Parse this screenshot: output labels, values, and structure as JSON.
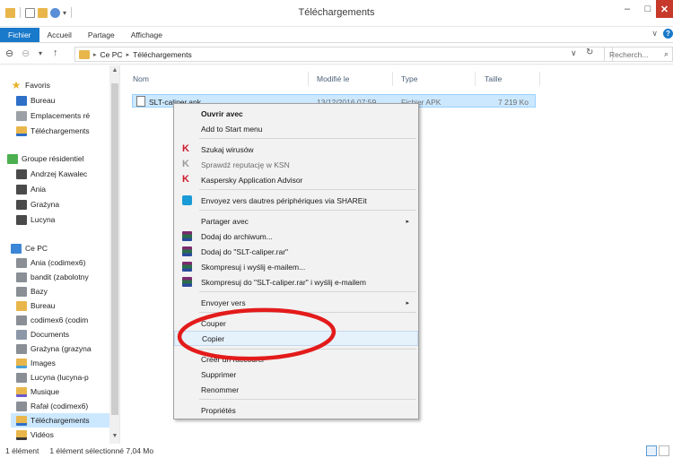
{
  "window": {
    "title": "Téléchargements",
    "min": "–",
    "max": "□",
    "close": "✕"
  },
  "ribbon": {
    "tabs": [
      "Fichier",
      "Accueil",
      "Partage",
      "Affichage"
    ],
    "expand": "∨",
    "help": "?"
  },
  "nav": {
    "back": "⊖",
    "forward": "⊖",
    "recent": "▾",
    "up": "↑",
    "path": [
      "Ce PC",
      "Téléchargements"
    ],
    "path_sep": "▸",
    "dropdown": "∨",
    "refresh": "↻",
    "search_placeholder": "Recherch...",
    "search_icon": "⌕"
  },
  "sidebar": {
    "items": [
      {
        "label": "Favoris",
        "icon": "star-icon"
      },
      {
        "label": "Bureau",
        "icon": "desktop-icon"
      },
      {
        "label": "Emplacements ré",
        "icon": "recent-places-icon"
      },
      {
        "label": "Téléchargements",
        "icon": "download-folder-icon"
      },
      {
        "label": "Groupe résidentiel",
        "icon": "homegroup-icon"
      },
      {
        "label": "Andrzej Kawalec",
        "icon": "user-icon"
      },
      {
        "label": "Ania",
        "icon": "user-icon"
      },
      {
        "label": "Grażyna",
        "icon": "user-icon"
      },
      {
        "label": "Lucyna",
        "icon": "user-icon"
      },
      {
        "label": "Ce PC",
        "icon": "computer-icon"
      },
      {
        "label": "Ania (codimex6)",
        "icon": "network-drive-icon"
      },
      {
        "label": "bandit (zabolotny",
        "icon": "network-drive-icon"
      },
      {
        "label": "Bazy",
        "icon": "network-drive-icon"
      },
      {
        "label": "Bureau",
        "icon": "folder-icon"
      },
      {
        "label": "codimex6 (codim",
        "icon": "network-drive-icon"
      },
      {
        "label": "Documents",
        "icon": "documents-icon"
      },
      {
        "label": "Grażyna (grazyna",
        "icon": "network-drive-icon"
      },
      {
        "label": "Images",
        "icon": "pictures-icon"
      },
      {
        "label": "Lucyna (lucyna-p",
        "icon": "network-drive-icon"
      },
      {
        "label": "Musique",
        "icon": "music-icon"
      },
      {
        "label": "Rafał (codimex6)",
        "icon": "network-drive-icon"
      },
      {
        "label": "Téléchargements",
        "icon": "download-folder-icon"
      },
      {
        "label": "Vidéos",
        "icon": "videos-icon"
      }
    ]
  },
  "columns": {
    "name": "Nom",
    "modified": "Modifié le",
    "type": "Type",
    "size": "Taille"
  },
  "file": {
    "name": "SLT-caliper.apk",
    "modified": "13/12/2016 07:59",
    "type": "Fichier APK",
    "size": "7 219 Ko"
  },
  "context_menu": {
    "items": [
      {
        "label": "Ouvrir avec"
      },
      {
        "label": "Add to Start menu"
      },
      {
        "label": "Szukaj wirusów"
      },
      {
        "label": "Sprawdź reputację w KSN"
      },
      {
        "label": "Kaspersky Application Advisor"
      },
      {
        "label": "Envoyez vers dautres périphériques via SHAREit"
      },
      {
        "label": "Partager avec"
      },
      {
        "label": "Dodaj do archiwum..."
      },
      {
        "label": "Dodaj do \"SLT-caliper.rar\""
      },
      {
        "label": "Skompresuj i wyślij e-mailem..."
      },
      {
        "label": "Skompresuj do \"SLT-caliper.rar\" i wyślij e-mailem"
      },
      {
        "label": "Envoyer vers"
      },
      {
        "label": "Couper"
      },
      {
        "label": "Copier"
      },
      {
        "label": "Créer un raccourci"
      },
      {
        "label": "Supprimer"
      },
      {
        "label": "Renommer"
      },
      {
        "label": "Propriétés"
      }
    ],
    "submenu_arrow": "▸",
    "kaspersky_glyph": "K",
    "highlight_color": "#e5f1fb",
    "annotation_color": "#e31b1b"
  },
  "status": {
    "count": "1 élément",
    "selection": "1 élément sélectionné  7,04 Mo"
  },
  "colors": {
    "file_tab": "#1979ca",
    "selection": "#cce8ff",
    "close_button": "#c7392b"
  }
}
